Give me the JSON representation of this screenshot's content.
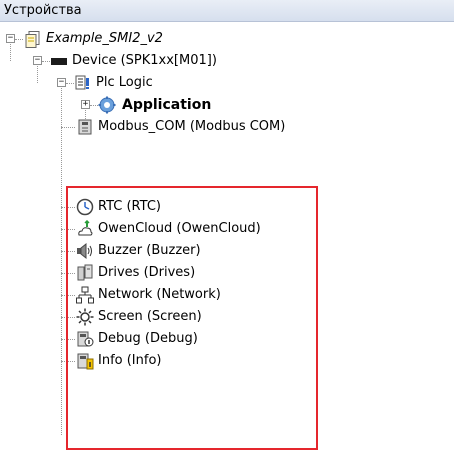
{
  "panel": {
    "title": "Устройства"
  },
  "tree": {
    "project": {
      "label": "Example_SMI2_v2"
    },
    "device": {
      "label": "Device (SPK1xx[M01])"
    },
    "plc_logic": {
      "label": "Plc Logic"
    },
    "application": {
      "label": "Application"
    },
    "modbus": {
      "label": "Modbus_COM (Modbus COM)"
    },
    "rtc": {
      "label": "RTC (RTC)"
    },
    "owencloud": {
      "label": "OwenCloud (OwenCloud)"
    },
    "buzzer": {
      "label": "Buzzer (Buzzer)"
    },
    "drives": {
      "label": "Drives (Drives)"
    },
    "network": {
      "label": "Network (Network)"
    },
    "screen": {
      "label": "Screen (Screen)"
    },
    "debug": {
      "label": "Debug (Debug)"
    },
    "info": {
      "label": "Info (Info)"
    }
  },
  "highlight": {
    "color": "#e5262d"
  }
}
